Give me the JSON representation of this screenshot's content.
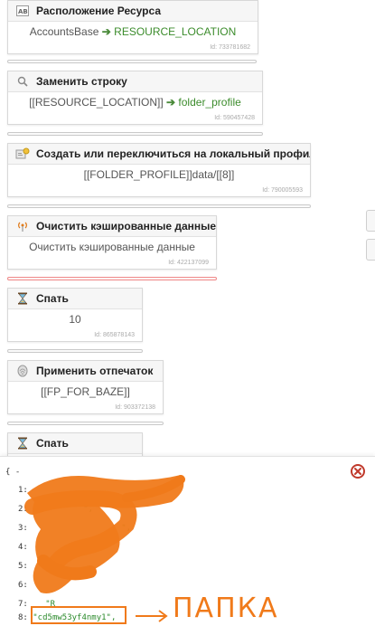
{
  "blocks": [
    {
      "title": "Расположение Ресурса",
      "icon": "resource-icon",
      "body_prefix": "AccountsBase",
      "body_var": "RESOURCE_LOCATION",
      "id": "Id: 733781682"
    },
    {
      "title": "Заменить строку",
      "icon": "search-icon",
      "body_prefix": "[[RESOURCE_LOCATION]]",
      "body_var": "folder_profile",
      "id": "Id: 590457428"
    },
    {
      "title": "Создать или переключиться на локальный профиль",
      "icon": "profile-icon",
      "body_text": "[[FOLDER_PROFILE]]data/[[8]]",
      "id": "Id: 790005593"
    },
    {
      "title": "Очистить кэшированные данные",
      "icon": "broadcast-icon",
      "body_text": "Очистить кэшированные данные",
      "id": "Id: 422137099"
    },
    {
      "title": "Спать",
      "icon": "hourglass-icon",
      "body_text": "10",
      "id": "Id: 865878143"
    },
    {
      "title": "Применить отпечаток",
      "icon": "fingerprint-icon",
      "body_text": "[[FP_FOR_BAZE]]",
      "id": "Id: 903372138"
    },
    {
      "title": "Спать",
      "icon": "hourglass-icon"
    }
  ],
  "json_viewer": {
    "open_text": "{ -",
    "lines": [
      {
        "num": "1:",
        "value": ""
      },
      {
        "num": "2:",
        "value": "\","
      },
      {
        "num": "3:",
        "value": "\","
      },
      {
        "num": "4:",
        "value": ""
      },
      {
        "num": "5:",
        "value": ""
      },
      {
        "num": "6:",
        "value": ""
      },
      {
        "num": "7:",
        "value": "\"R"
      },
      {
        "num": "8:",
        "value": "\"cd5mw53yf4nmy1\","
      }
    ]
  },
  "annotation": {
    "label": "ПАПКА",
    "color": "#f07a1a"
  },
  "colors": {
    "accent_green": "#3c8c2c",
    "highlight_orange": "#f07a1a",
    "error_red": "#ef8a8a"
  }
}
